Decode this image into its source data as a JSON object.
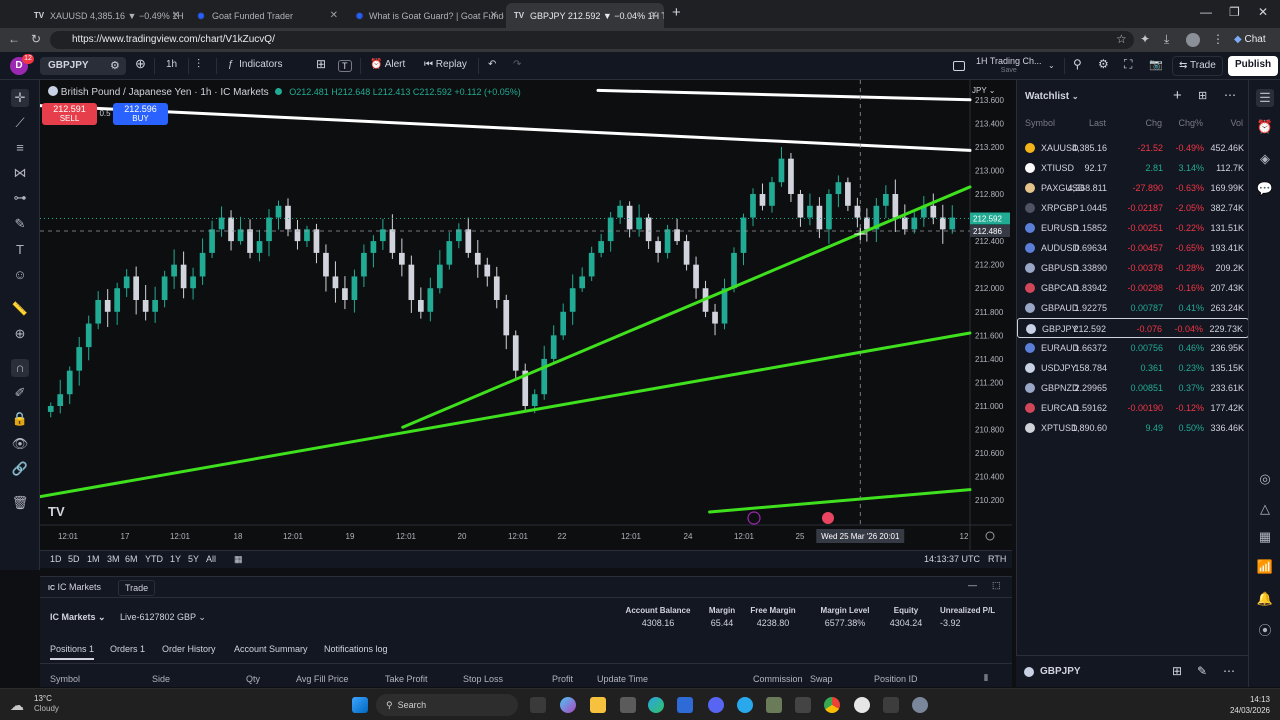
{
  "browser": {
    "tabs": [
      {
        "label": "XAUUSD 4,385.16 ▼ −0.49% 1H Ti..."
      },
      {
        "label": "Goat Funded Trader"
      },
      {
        "label": "What is Goat Guard? | Goat Funde..."
      },
      {
        "label": "GBPJPY 212.592 ▼ −0.04% 1H Tra..."
      }
    ],
    "url": "https://www.tradingview.com/chart/V1kZucvQ/",
    "chat_label": "Chat"
  },
  "toolbar": {
    "avatar_letter": "D",
    "notif_count": "12",
    "symbol": "GBPJPY",
    "interval": "1h",
    "indicators_label": "Indicators",
    "alert_label": "Alert",
    "replay_label": "Replay",
    "layout_name": "1H Trading Ch...",
    "layout_sub": "Save",
    "trade_label": "Trade",
    "publish_label": "Publish"
  },
  "legend": {
    "title": "British Pound / Japanese Yen · 1h · IC Markets",
    "ohlc": "O212.481  H212.648  L212.413  C212.592  +0.112 (+0.05%)",
    "sell_price": "212.591",
    "sell_label": "SELL",
    "spread": "0.5",
    "buy_price": "212.596",
    "buy_label": "BUY",
    "currency": "JPY"
  },
  "chart_data": {
    "type": "candlestick",
    "symbol": "GBPJPY",
    "interval": "1h",
    "y_ticks": [
      "213.600",
      "213.400",
      "213.200",
      "213.000",
      "212.800",
      "212.400",
      "212.200",
      "212.000",
      "211.800",
      "211.600",
      "211.400",
      "211.200",
      "211.000",
      "210.800",
      "210.600",
      "210.400",
      "210.200"
    ],
    "y_tick_values": [
      213.6,
      213.4,
      213.2,
      213.0,
      212.8,
      212.4,
      212.2,
      212.0,
      211.8,
      211.6,
      211.4,
      211.2,
      211.0,
      210.8,
      210.6,
      210.4,
      210.2
    ],
    "x_ticks": [
      "12:01",
      "17",
      "12:01",
      "18",
      "12:01",
      "19",
      "12:01",
      "20",
      "12:01",
      "22",
      "12:01",
      "24",
      "12:01",
      "25",
      "12"
    ],
    "ylim": [
      210.1,
      213.7
    ],
    "last_price": "212.592",
    "crosshair_price": "212.486",
    "crosshair_time": "Wed 25 Mar '26   20:01",
    "trendlines": [
      {
        "color": "#ffffff",
        "from": [
          0,
          213.55
        ],
        "to": [
          1,
          213.17
        ]
      },
      {
        "color": "#ffffff",
        "from": [
          0.6,
          213.68
        ],
        "to": [
          1,
          213.6
        ]
      },
      {
        "color": "#3fe01d",
        "from": [
          0.39,
          210.82
        ],
        "to": [
          1,
          212.86
        ]
      },
      {
        "color": "#3fe01d",
        "from": [
          0,
          210.23
        ],
        "to": [
          1,
          211.62
        ]
      },
      {
        "color": "#3fe01d",
        "from": [
          0.72,
          210.1
        ],
        "to": [
          1,
          210.29
        ]
      }
    ],
    "closes": [
      211.0,
      211.1,
      211.3,
      211.5,
      211.7,
      211.9,
      211.8,
      212.0,
      212.1,
      211.9,
      211.8,
      211.9,
      212.1,
      212.2,
      212.0,
      212.1,
      212.3,
      212.5,
      212.6,
      212.4,
      212.5,
      212.3,
      212.4,
      212.6,
      212.7,
      212.5,
      212.4,
      212.5,
      212.3,
      212.1,
      212.0,
      211.9,
      212.1,
      212.3,
      212.4,
      212.5,
      212.3,
      212.2,
      211.9,
      211.8,
      212.0,
      212.2,
      212.4,
      212.5,
      212.3,
      212.2,
      212.1,
      211.9,
      211.6,
      211.3,
      211.0,
      211.1,
      211.4,
      211.6,
      211.8,
      212.0,
      212.1,
      212.3,
      212.4,
      212.6,
      212.7,
      212.5,
      212.6,
      212.4,
      212.3,
      212.5,
      212.4,
      212.2,
      212.0,
      211.8,
      211.7,
      212.0,
      212.3,
      212.6,
      212.8,
      212.7,
      212.9,
      213.1,
      212.8,
      212.6,
      212.7,
      212.5,
      212.8,
      212.9,
      212.7,
      212.6,
      212.5,
      212.7,
      212.8,
      212.6,
      212.5,
      212.6,
      212.7,
      212.6,
      212.5,
      212.6
    ]
  },
  "timezone": "14:13:37 UTC",
  "session": "RTH",
  "ranges": [
    "1D",
    "5D",
    "1M",
    "3M",
    "6M",
    "YTD",
    "1Y",
    "5Y",
    "All"
  ],
  "panel": {
    "broker": "IC Markets",
    "trade_tab": "Trade",
    "broker_select": "IC Markets",
    "account": "Live-6127802 GBP",
    "metrics": [
      {
        "label": "Account Balance",
        "value": "4308.16"
      },
      {
        "label": "Margin",
        "value": "65.44"
      },
      {
        "label": "Free Margin",
        "value": "4238.80"
      },
      {
        "label": "Margin Level",
        "value": "6577.38%"
      },
      {
        "label": "Equity",
        "value": "4304.24"
      },
      {
        "label": "Unrealized P/L",
        "value": "-3.92"
      }
    ],
    "tabs": [
      "Positions 1",
      "Orders 1",
      "Order History",
      "Account Summary",
      "Notifications log"
    ],
    "columns": [
      "Symbol",
      "Side",
      "Qty",
      "Avg Fill Price",
      "Take Profit",
      "Stop Loss",
      "Profit",
      "Update Time",
      "Commission",
      "Swap",
      "Position ID"
    ]
  },
  "watchlist": {
    "title": "Watchlist",
    "columns": [
      "Symbol",
      "Last",
      "Chg",
      "Chg%",
      "Vol"
    ],
    "rows": [
      {
        "symbol": "XAUUSD",
        "last": "4,385.16",
        "chg": "-21.52",
        "chgp": "-0.49%",
        "vol": "452.46K",
        "color": "#f2b41b",
        "dir": "down"
      },
      {
        "symbol": "XTIUSD",
        "last": "92.17",
        "chg": "2.81",
        "chgp": "3.14%",
        "vol": "112.7K",
        "color": "#ffffff",
        "dir": "up"
      },
      {
        "symbol": "PAXGUSD",
        "last": "4,368.811",
        "chg": "-27.890",
        "chgp": "-0.63%",
        "vol": "169.99K",
        "color": "#e4c48a",
        "dir": "down"
      },
      {
        "symbol": "XRPGBP",
        "last": "1.0445",
        "chg": "-0.02187",
        "chgp": "-2.05%",
        "vol": "382.74K",
        "color": "#4d5363",
        "dir": "down"
      },
      {
        "symbol": "EURUSD",
        "last": "1.15852",
        "chg": "-0.00251",
        "chgp": "-0.22%",
        "vol": "131.51K",
        "color": "#5b7ed8",
        "dir": "down"
      },
      {
        "symbol": "AUDUSD",
        "last": "0.69634",
        "chg": "-0.00457",
        "chgp": "-0.65%",
        "vol": "193.41K",
        "color": "#5b7ed8",
        "dir": "down"
      },
      {
        "symbol": "GBPUSD",
        "last": "1.33890",
        "chg": "-0.00378",
        "chgp": "-0.28%",
        "vol": "209.2K",
        "color": "#9aa6c7",
        "dir": "down"
      },
      {
        "symbol": "GBPCAD",
        "last": "1.83942",
        "chg": "-0.00298",
        "chgp": "-0.16%",
        "vol": "207.43K",
        "color": "#d1475a",
        "dir": "down"
      },
      {
        "symbol": "GBPAUD",
        "last": "1.92275",
        "chg": "0.00787",
        "chgp": "0.41%",
        "vol": "263.24K",
        "color": "#9aa6c7",
        "dir": "up"
      },
      {
        "symbol": "GBPJPY",
        "last": "212.592",
        "chg": "-0.076",
        "chgp": "-0.04%",
        "vol": "229.73K",
        "color": "#c9d1e6",
        "dir": "down"
      },
      {
        "symbol": "EURAUD",
        "last": "1.66372",
        "chg": "0.00756",
        "chgp": "0.46%",
        "vol": "236.95K",
        "color": "#5b7ed8",
        "dir": "up"
      },
      {
        "symbol": "USDJPY",
        "last": "158.784",
        "chg": "0.361",
        "chgp": "0.23%",
        "vol": "135.15K",
        "color": "#c9d1e6",
        "dir": "up"
      },
      {
        "symbol": "GBPNZD",
        "last": "2.29965",
        "chg": "0.00851",
        "chgp": "0.37%",
        "vol": "233.61K",
        "color": "#9aa6c7",
        "dir": "up"
      },
      {
        "symbol": "EURCAD",
        "last": "1.59162",
        "chg": "-0.00190",
        "chgp": "-0.12%",
        "vol": "177.42K",
        "color": "#d1475a",
        "dir": "down"
      },
      {
        "symbol": "XPTUSD",
        "last": "1,890.60",
        "chg": "9.49",
        "chgp": "0.50%",
        "vol": "336.46K",
        "color": "#cfd2d9",
        "dir": "up"
      }
    ],
    "footer_symbol": "GBPJPY"
  },
  "colors": {
    "up": "#22ab94",
    "down": "#f23645",
    "accent": "#2962ff",
    "trendline": "#3fe01d"
  },
  "taskbar": {
    "weather_temp": "13°C",
    "weather_desc": "Cloudy",
    "search_placeholder": "Search",
    "time": "14:13",
    "date": "24/03/2026"
  }
}
